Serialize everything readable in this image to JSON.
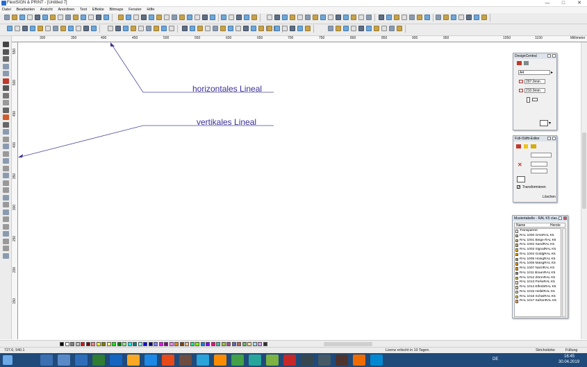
{
  "window": {
    "title": "FlexiSIGN & PRINT - [Untitled 7]",
    "minimize": "—",
    "maximize": "□",
    "close": "✕"
  },
  "menu": [
    "Datei",
    "Bearbeiten",
    "Ansicht",
    "Anordnen",
    "Text",
    "Effekte",
    "Bitmaps",
    "Fenster",
    "Hilfe"
  ],
  "ruler": {
    "h_ticks": [
      "300",
      "350",
      "400",
      "450",
      "500",
      "550",
      "600",
      "650",
      "700",
      "750",
      "800",
      "850",
      "900",
      "950",
      "1050",
      "1150"
    ],
    "unit": "Millimeter",
    "v_ticks": [
      "550",
      "500",
      "450",
      "400",
      "350",
      "300",
      "250",
      "200",
      "150"
    ]
  },
  "annotations": {
    "horizontal": "horizontales Lineal",
    "vertical": "vertikales Lineal"
  },
  "design_central": {
    "title": "DesignCentral",
    "preset": "A4",
    "width": "297.0mm",
    "height": "210.0mm"
  },
  "fill_editor": {
    "title": "Füll-/Stiftt-Editor",
    "transform_label": "Transformieren",
    "delete_label": "Löschen"
  },
  "swatch_table": {
    "title": "Mustertabelle - RAL K5 clas...",
    "col_name": "Name",
    "col_source": "Herste",
    "rows": [
      {
        "label": "Transparent",
        "color": "#ffffff"
      },
      {
        "label": "RAL 1000 GrünRAL K5",
        "color": "#c5b98a"
      },
      {
        "label": "RAL 1001 Beige RAL K5",
        "color": "#d1b88a"
      },
      {
        "label": "RAL 1002 SandRAL K5",
        "color": "#d2aa6d"
      },
      {
        "label": "RAL 1003 SignalRAL K5",
        "color": "#f5b800"
      },
      {
        "label": "RAL 1004 GoldgRAL K5",
        "color": "#e4a700"
      },
      {
        "label": "RAL 1005 HonigRAL K5",
        "color": "#c99a00"
      },
      {
        "label": "RAL 1006 MaisgRAL K5",
        "color": "#e29c00"
      },
      {
        "label": "RAL 1007 NarziRAL K5",
        "color": "#df9200"
      },
      {
        "label": "RAL 1011 BraunRAL K5",
        "color": "#a4845c"
      },
      {
        "label": "RAL 1012 ZitronRAL K5",
        "color": "#d8c04a"
      },
      {
        "label": "RAL 1013 PerlwRAL K5",
        "color": "#ebe5d2"
      },
      {
        "label": "RAL 1014 ElfenbRAL K5",
        "color": "#dfcea1"
      },
      {
        "label": "RAL 1015 HellelRAL K5",
        "color": "#e8dbb6"
      },
      {
        "label": "RAL 1016 SchwiRAL K5",
        "color": "#f0e44a"
      },
      {
        "label": "RAL 1017 SafranRAL K5",
        "color": "#f3a54a"
      }
    ]
  },
  "palette_colors": [
    "#000000",
    "#ffffff",
    "#808080",
    "#c0c0c0",
    "#ff0000",
    "#800000",
    "#ff8080",
    "#ffff00",
    "#808000",
    "#ffff80",
    "#00ff00",
    "#008000",
    "#80ff80",
    "#00ffff",
    "#008080",
    "#80ffff",
    "#0000ff",
    "#000080",
    "#8080ff",
    "#ff00ff",
    "#800080",
    "#ff80ff",
    "#ff8000",
    "#804000",
    "#ffc080",
    "#00ff80",
    "#80ff00",
    "#0080ff",
    "#8000ff",
    "#ff0080",
    "#40c0a0",
    "#a0c040",
    "#c040a0",
    "#6060c0",
    "#c06060",
    "#60c060",
    "#f0e0a0",
    "#a0e0f0",
    "#e0a0f0",
    "#303030"
  ],
  "status": {
    "coords": "727.6,    540.1",
    "license": "Lizenz erlischt in 10 Tagen.",
    "stroke": "Strichstärke",
    "fill": "Füllung"
  },
  "taskbar": {
    "lang": "DE",
    "time": "16:45",
    "date": "30.04.2019",
    "apps": [
      "#3c6fb0",
      "#5a8ac6",
      "#2f6db8",
      "#2e7d32",
      "#1565c0",
      "#f9a825",
      "#1e88e5",
      "#e64a19",
      "#6d4c41",
      "#2aa3d8",
      "#fb8c00",
      "#43a047",
      "#26a69a",
      "#7cb342",
      "#c62828",
      "#37474f",
      "#455a64",
      "#4e342e",
      "#ef6c00",
      "#0288d1"
    ]
  },
  "colors": {
    "accent": "#3b2f9a",
    "toolbar": "#ececec",
    "taskbar": "#1f4a7a"
  }
}
